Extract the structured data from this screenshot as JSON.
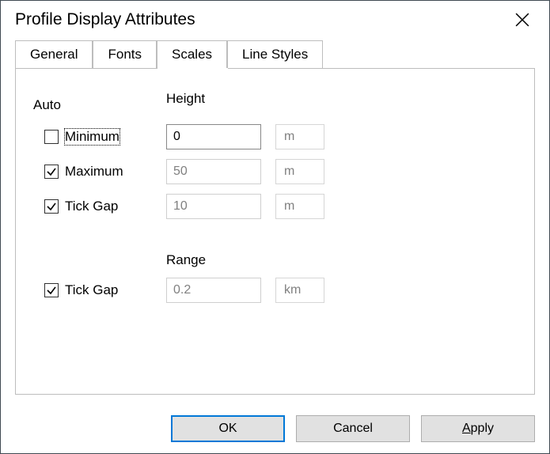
{
  "window": {
    "title": "Profile Display Attributes"
  },
  "tabs": {
    "general": "General",
    "fonts": "Fonts",
    "scales": "Scales",
    "lineStyles": "Line Styles",
    "active": "scales"
  },
  "scales": {
    "autoLabel": "Auto",
    "height": {
      "label": "Height",
      "minimum": {
        "label": "Minimum",
        "checked": false,
        "value": "0",
        "unit": "m",
        "enabled": true
      },
      "maximum": {
        "label": "Maximum",
        "checked": true,
        "value": "50",
        "unit": "m",
        "enabled": false
      },
      "tickgap": {
        "label": "Tick Gap",
        "checked": true,
        "value": "10",
        "unit": "m",
        "enabled": false
      }
    },
    "range": {
      "label": "Range",
      "tickgap": {
        "label": "Tick Gap",
        "checked": true,
        "value": "0.2",
        "unit": "km",
        "enabled": false
      }
    }
  },
  "buttons": {
    "ok": "OK",
    "cancel": "Cancel",
    "applyPrefix": "A",
    "applyRest": "pply"
  }
}
